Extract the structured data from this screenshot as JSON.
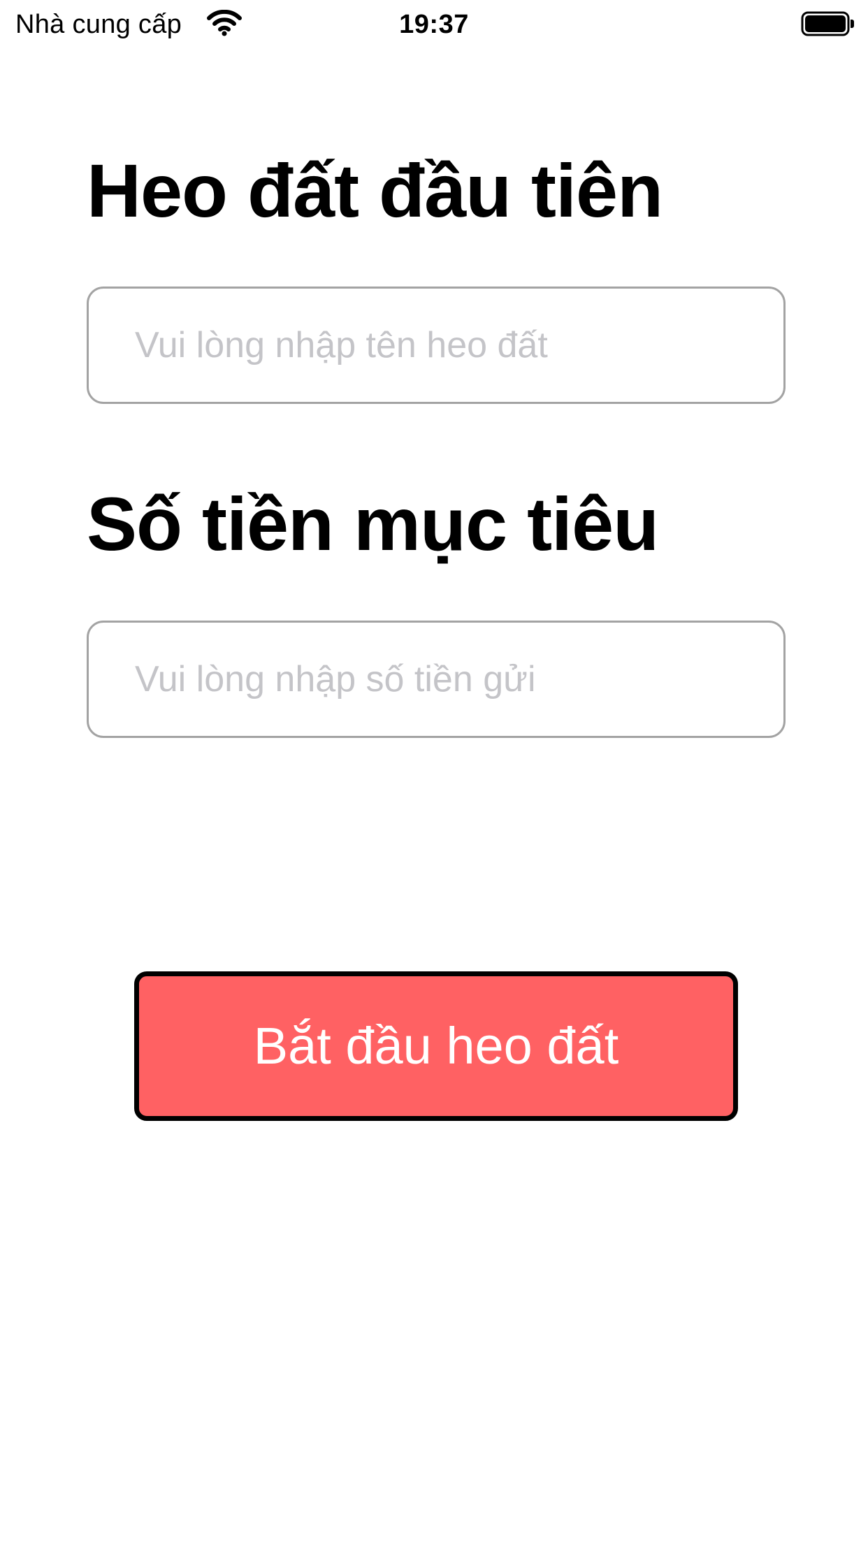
{
  "status_bar": {
    "carrier": "Nhà cung cấp",
    "time": "19:37",
    "wifi_icon": "wifi-icon",
    "battery_icon": "battery-full-icon"
  },
  "form": {
    "name_section": {
      "title": "Heo đất đầu tiên",
      "placeholder": "Vui lòng nhập tên heo đất",
      "value": ""
    },
    "amount_section": {
      "title": "Số tiền mục tiêu",
      "placeholder": "Vui lòng nhập số tiền gửi",
      "value": ""
    },
    "submit_label": "Bắt đầu heo đất"
  },
  "colors": {
    "button_background": "#ff6163",
    "button_border": "#000000",
    "button_text": "#ffffff",
    "field_border": "#a3a3a3",
    "placeholder": "#c4c4c8"
  }
}
